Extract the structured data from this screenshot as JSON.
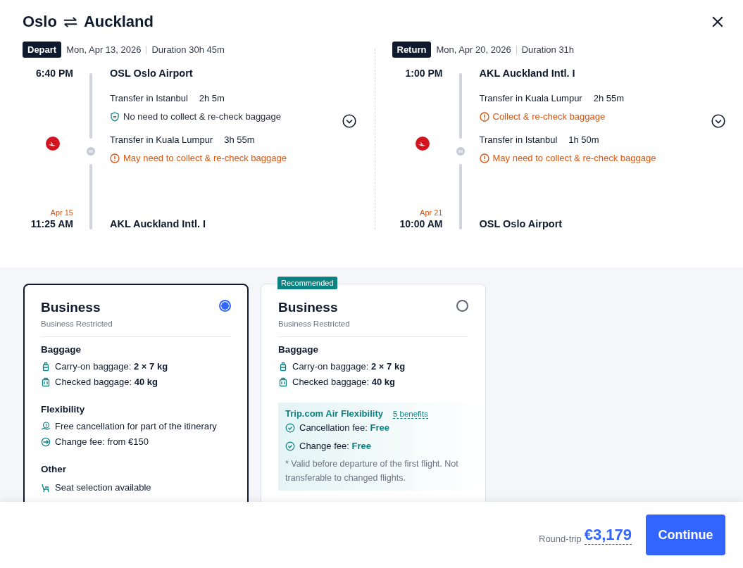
{
  "header": {
    "from": "Oslo",
    "to": "Auckland"
  },
  "legs": [
    {
      "badge": "Depart",
      "date": "Mon, Apr 13, 2026",
      "duration": "Duration 30h 45m",
      "dep_time": "6:40 PM",
      "dep_airport": "OSL Oslo Airport",
      "transfers": [
        {
          "text": "Transfer in Istanbul",
          "duration": "2h 5m",
          "baggage": {
            "kind": "ok",
            "text": "No need to collect & re-check baggage"
          }
        },
        {
          "text": "Transfer in Kuala Lumpur",
          "duration": "3h 55m",
          "baggage": {
            "kind": "warn",
            "text": "May need to collect & re-check baggage"
          }
        }
      ],
      "arr_date": "Apr 15",
      "arr_time": "11:25 AM",
      "arr_airport": "AKL Auckland Intl. I"
    },
    {
      "badge": "Return",
      "date": "Mon, Apr 20, 2026",
      "duration": "Duration 31h",
      "dep_time": "1:00 PM",
      "dep_airport": "AKL Auckland Intl. I",
      "transfers": [
        {
          "text": "Transfer in Kuala Lumpur",
          "duration": "2h 55m",
          "baggage": {
            "kind": "warn",
            "text": "Collect & re-check baggage"
          }
        },
        {
          "text": "Transfer in Istanbul",
          "duration": "1h 50m",
          "baggage": {
            "kind": "warn",
            "text": "May need to collect & re-check baggage"
          }
        }
      ],
      "arr_date": "Apr 21",
      "arr_time": "10:00 AM",
      "arr_airport": "OSL Oslo Airport"
    }
  ],
  "fares": [
    {
      "selected": true,
      "title": "Business",
      "subtitle": "Business Restricted",
      "sections": [
        {
          "kind": "list",
          "heading": "Baggage",
          "items": [
            {
              "kind": "carry-on",
              "text": "Carry-on baggage: **2 × 7 kg**"
            },
            {
              "kind": "checked",
              "text": "Checked baggage: **40 kg**"
            }
          ]
        },
        {
          "kind": "list",
          "heading": "Flexibility",
          "items": [
            {
              "kind": "refund",
              "text": "Free cancellation for part of the itinerary"
            },
            {
              "kind": "change",
              "text": "Change fee: from €150"
            }
          ]
        },
        {
          "kind": "list",
          "heading": "Other",
          "items": [
            {
              "kind": "seat",
              "text": "Seat selection available"
            }
          ]
        }
      ]
    },
    {
      "selected": false,
      "badge": "Recommended",
      "title": "Business",
      "subtitle": "Business Restricted",
      "sections": [
        {
          "kind": "list",
          "heading": "Baggage",
          "items": [
            {
              "kind": "carry-on",
              "text": "Carry-on baggage: **2 × 7 kg**"
            },
            {
              "kind": "checked",
              "text": "Checked baggage: **40 kg**"
            }
          ]
        },
        {
          "kind": "promo",
          "heading": "Trip.com Air Flexibility",
          "link": "5 benefits",
          "items": [
            {
              "kind": "check",
              "text": "Cancellation fee: **Free**"
            },
            {
              "kind": "check",
              "text": "Change fee: **Free**"
            }
          ],
          "note": "* Valid before departure of the first flight. Not transferable to changed flights."
        }
      ]
    }
  ],
  "footer": {
    "label": "Round-trip",
    "price": "€3,179",
    "button": "Continue"
  }
}
